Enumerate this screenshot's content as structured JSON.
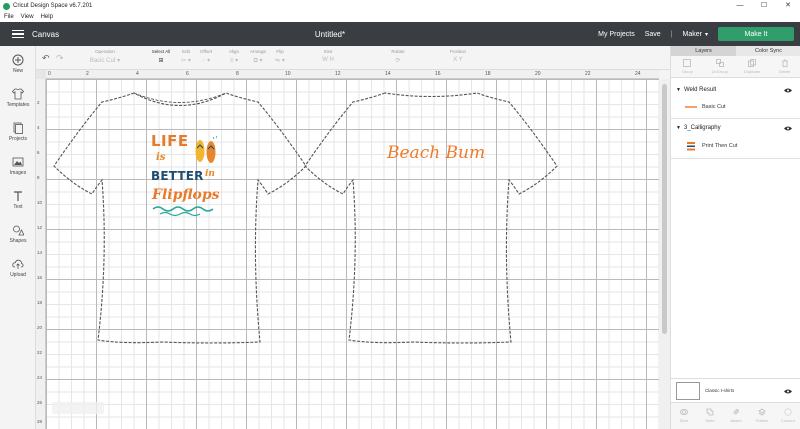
{
  "window": {
    "title": "Cricut Design Space  v6.7.201",
    "controls": [
      "—",
      "☐",
      "✕"
    ]
  },
  "menubar": {
    "items": [
      "File",
      "View",
      "Help"
    ]
  },
  "header": {
    "section": "Canvas",
    "doc_title": "Untitled*",
    "my_projects": "My Projects",
    "save": "Save",
    "separator": "|",
    "machine": "Maker",
    "make_it": "Make It"
  },
  "toolbar": {
    "items": [
      {
        "label": "Operation",
        "control": "Basic Cut ▾",
        "enabled": false
      },
      {
        "label": "Select All",
        "control": "⊞",
        "enabled": true
      },
      {
        "label": "Edit",
        "control": "✂ ▾",
        "enabled": false
      },
      {
        "label": "Offset",
        "control": "◌ ▾",
        "enabled": false
      },
      {
        "label": "Align",
        "control": "≡ ▾",
        "enabled": false
      },
      {
        "label": "Arrange",
        "control": "⧉ ▾",
        "enabled": false
      },
      {
        "label": "Flip",
        "control": "⇋ ▾",
        "enabled": false
      },
      {
        "label": "Size",
        "control": "W   H",
        "enabled": false
      },
      {
        "label": "Rotate",
        "control": "⟳",
        "enabled": false
      },
      {
        "label": "Position",
        "control": "X   Y",
        "enabled": false
      }
    ]
  },
  "sidebar": {
    "items": [
      {
        "label": "New",
        "icon": "plus-circle-icon"
      },
      {
        "label": "Templates",
        "icon": "shirt-icon"
      },
      {
        "label": "Projects",
        "icon": "projects-icon"
      },
      {
        "label": "Images",
        "icon": "image-icon"
      },
      {
        "label": "Text",
        "icon": "text-icon"
      },
      {
        "label": "Shapes",
        "icon": "shapes-icon"
      },
      {
        "label": "Upload",
        "icon": "upload-icon"
      }
    ]
  },
  "rulers": {
    "top": [
      "0",
      "2",
      "4",
      "6",
      "8",
      "10",
      "12",
      "14",
      "16",
      "18",
      "20",
      "22",
      "24"
    ],
    "left": [
      "2",
      "4",
      "6",
      "8",
      "10",
      "12",
      "14",
      "16",
      "18",
      "20",
      "22",
      "24",
      "26",
      "28"
    ]
  },
  "canvas": {
    "design1": {
      "line1": "LIFE",
      "line2": "is",
      "line3": "BETTER",
      "line4": "in",
      "line5": "Flipflops"
    },
    "design2": {
      "text": "Beach Bum"
    }
  },
  "panel": {
    "tabs": [
      "Layers",
      "Color Sync"
    ],
    "tools_top": [
      "Group",
      "UnGroup",
      "Duplicate",
      "Delete"
    ],
    "groups": [
      {
        "name": "Weld Result",
        "child": "Basic Cut"
      },
      {
        "name": "3_Calligraphy",
        "child": "Print Then Cut"
      }
    ],
    "canvas_layer": "Classic t-shirts",
    "tools_bottom": [
      "Slice",
      "Weld",
      "Attach",
      "Flatten",
      "Contour"
    ]
  },
  "colors": {
    "header_bg": "#3a3e43",
    "make_it": "#2f9e6a",
    "orange": "#e87a2c",
    "navy": "#1e4c70",
    "teal": "#2aa79b"
  }
}
